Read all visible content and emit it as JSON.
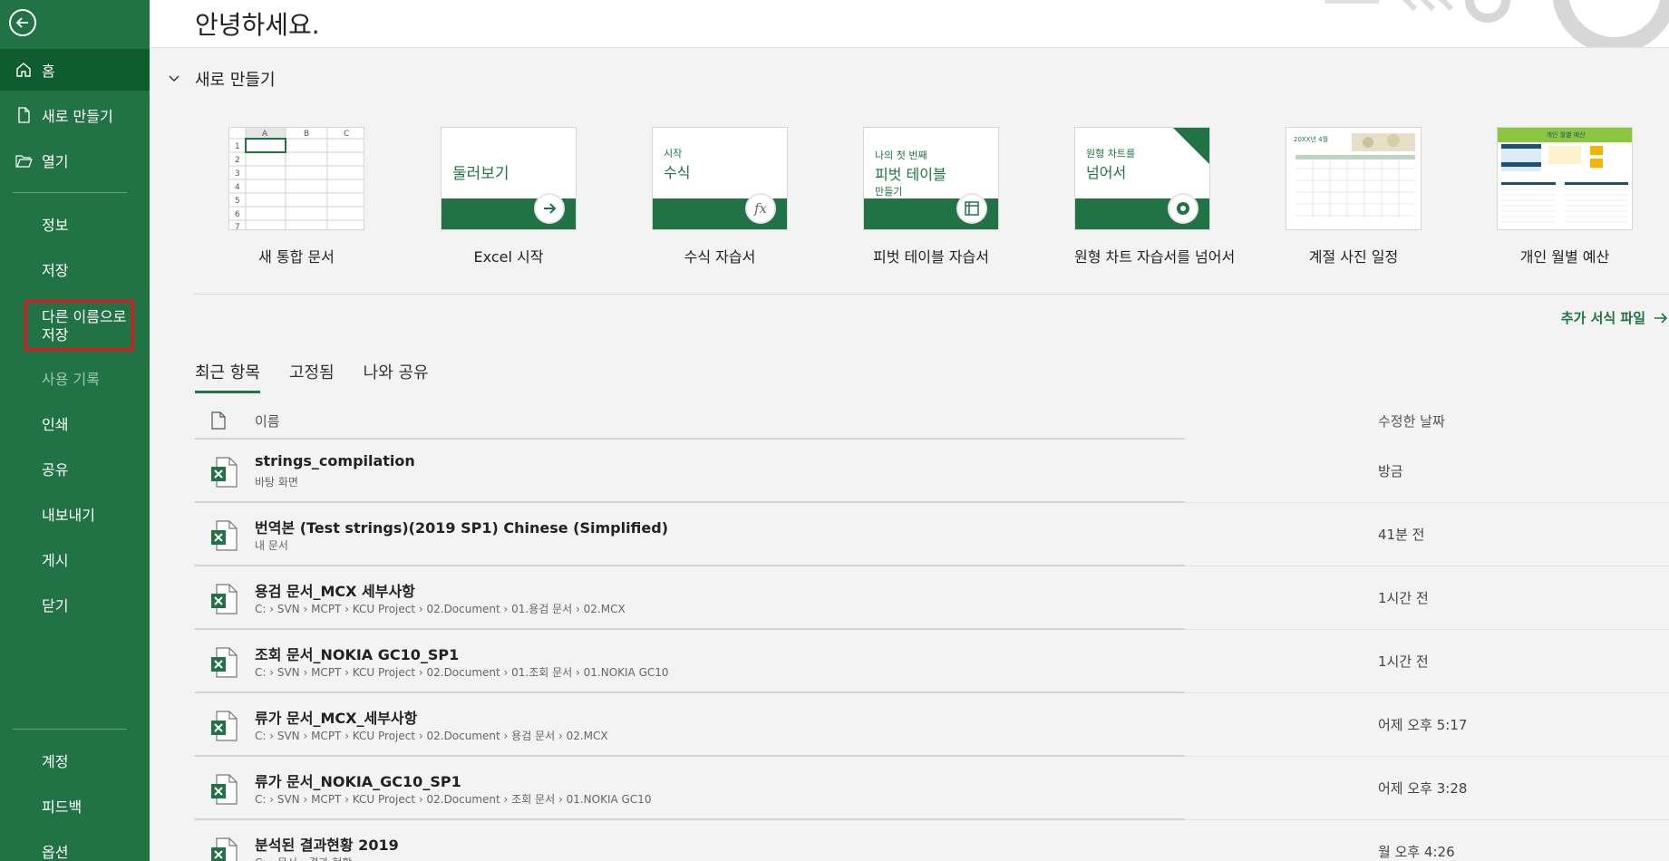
{
  "sidebar": {
    "home": "홈",
    "new": "새로 만들기",
    "open": "열기",
    "info": "정보",
    "save": "저장",
    "save_as": "다른 이름으로 저장",
    "history": "사용 기록",
    "print": "인쇄",
    "share": "공유",
    "export": "내보내기",
    "publish": "게시",
    "close": "닫기",
    "account": "계정",
    "feedback": "피드백",
    "options": "옵션"
  },
  "greeting": "안녕하세요.",
  "new_section": {
    "title": "새로 만들기",
    "templates": [
      {
        "caption": "새 통합 문서"
      },
      {
        "caption": "Excel 시작",
        "thumb_text": "둘러보기"
      },
      {
        "caption": "수식 자습서",
        "thumb_small": "시작",
        "thumb_text": "수식"
      },
      {
        "caption": "피벗 테이블 자습서",
        "thumb_small": "나의 첫 번째",
        "thumb_text": "피벗 테이블",
        "thumb_sub": "만들기"
      },
      {
        "caption": "원형 차트 자습서를 넘어서",
        "thumb_small": "원형 차트를",
        "thumb_text": "넘어서"
      },
      {
        "caption": "계절 사진 일정",
        "thumb_small": "20XX년 4월"
      },
      {
        "caption": "개인 월별 예산",
        "thumb_small": "개인 월별 예산"
      }
    ],
    "more_link": "추가 서식 파일"
  },
  "recent": {
    "tabs": [
      "최근 항목",
      "고정됨",
      "나와 공유"
    ],
    "header_name": "이름",
    "header_date": "수정한 날짜",
    "files": [
      {
        "name": "strings_compilation",
        "path": "바탕 화면",
        "date": "방금"
      },
      {
        "name": "번역본 (Test strings)(2019 SP1) Chinese (Simplified)",
        "path": "내 문서",
        "date": "41분 전"
      },
      {
        "name": "용검 문서_MCX 세부사항",
        "path": "C: › SVN › MCPT › KCU Project › 02.Document › 01.용검 문서 › 02.MCX",
        "date": "1시간 전"
      },
      {
        "name": "조회 문서_NOKIA GC10_SP1",
        "path": "C: › SVN › MCPT › KCU Project › 02.Document › 01.조회 문서 › 01.NOKIA GC10",
        "date": "1시간 전"
      },
      {
        "name": "류가 문서_MCX_세부사항",
        "path": "C: › SVN › MCPT › KCU Project › 02.Document › 용검 문서 › 02.MCX",
        "date": "어제 오후 5:17"
      },
      {
        "name": "류가 문서_NOKIA_GC10_SP1",
        "path": "C: › SVN › MCPT › KCU Project › 02.Document › 조회 문서 › 01.NOKIA GC10",
        "date": "어제 오후 3:28"
      },
      {
        "name": "분석된 결과현황 2019",
        "path": "C: › 문서 › 결과 현황",
        "date": "월 오후 4:26"
      }
    ]
  },
  "colors": {
    "brand": "#217346",
    "active_nav": "#0e5c2f",
    "highlight": "#e81123"
  }
}
